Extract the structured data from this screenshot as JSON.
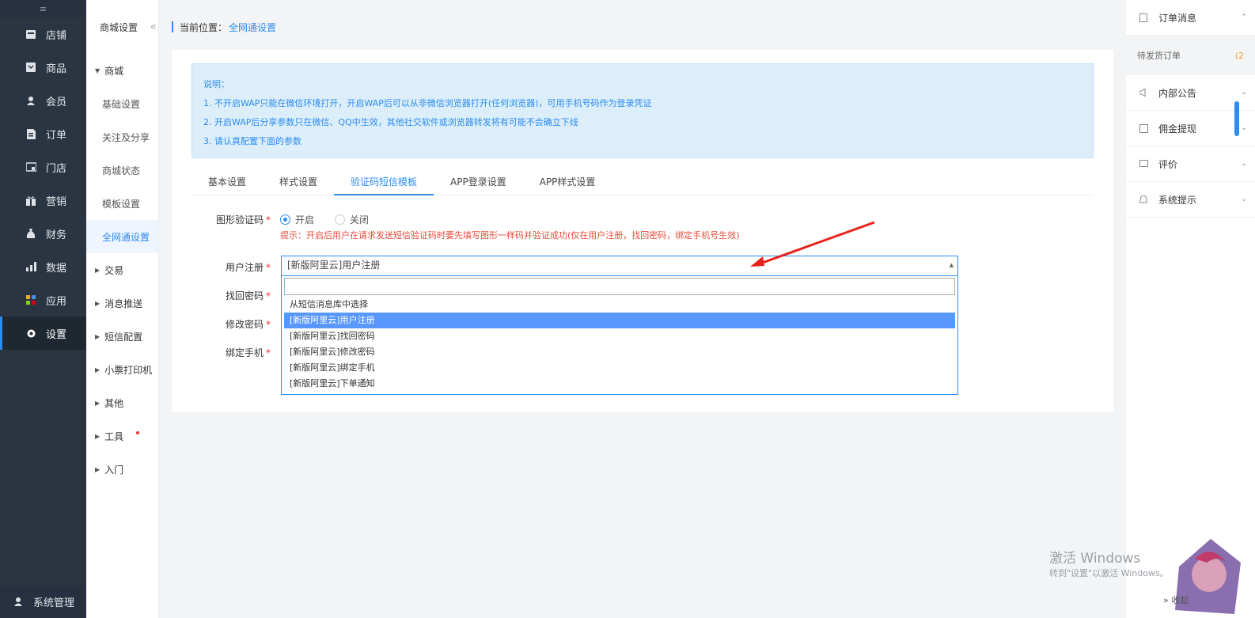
{
  "nav": {
    "toggle": "≡",
    "items": [
      {
        "label": "店铺"
      },
      {
        "label": "商品"
      },
      {
        "label": "会员"
      },
      {
        "label": "订单"
      },
      {
        "label": "门店"
      },
      {
        "label": "营销"
      },
      {
        "label": "财务"
      },
      {
        "label": "数据"
      },
      {
        "label": "应用"
      },
      {
        "label": "设置"
      }
    ],
    "bottom": "系统管理"
  },
  "subnav": {
    "title": "商城设置",
    "fold": "«",
    "mall_group": "商城",
    "mall_items": [
      "基础设置",
      "关注及分享",
      "商城状态",
      "模板设置",
      "全网通设置"
    ],
    "groups": [
      "交易",
      "消息推送",
      "短信配置",
      "小票打印机",
      "其他",
      "工具",
      "入门"
    ]
  },
  "breadcrumb": {
    "prefix": "当前位置：",
    "current": "全网通设置"
  },
  "notice": {
    "title": "说明：",
    "lines": [
      "1. 不开启WAP只能在微信环境打开，开启WAP后可以从非微信浏览器打开(任何浏览器)，可用手机号码作为登录凭证",
      "2. 开启WAP后分享参数只在微信、QQ中生效，其他社交软件或浏览器转发将有可能不会确立下线",
      "3. 请认真配置下面的参数"
    ]
  },
  "tabs": [
    "基本设置",
    "样式设置",
    "验证码短信模板",
    "APP登录设置",
    "APP样式设置"
  ],
  "form": {
    "captcha_label": "图形验证码",
    "radio_on": "开启",
    "radio_off": "关闭",
    "tip": "提示：开启后用户在请求发送短信验证码时要先填写图形一样码并验证成功(仅在用户注册，找回密码，绑定手机号生效)",
    "register_label": "用户注册",
    "findpwd_label": "找回密码",
    "changepwd_label": "修改密码",
    "bindphone_label": "绑定手机",
    "star": "*",
    "select_value": "[新版阿里云]用户注册",
    "options": [
      "从短信消息库中选择",
      "[新版阿里云]用户注册",
      "[新版阿里云]找回密码",
      "[新版阿里云]修改密码",
      "[新版阿里云]绑定手机",
      "[新版阿里云]下单通知"
    ]
  },
  "right_panel": {
    "order_msg": "订单消息",
    "pending": "待发货订单",
    "pending_count": "(2",
    "notice": "内部公告",
    "commission": "佣金提现",
    "review": "评价",
    "system": "系统提示",
    "collapse": "» 收起"
  },
  "watermark": {
    "line1": "激活 Windows",
    "line2": "转到\"设置\"以激活 Windows。"
  },
  "colors": {
    "accent": "#2d8cf0",
    "nav_bg": "#2b3542",
    "danger": "#e33"
  }
}
